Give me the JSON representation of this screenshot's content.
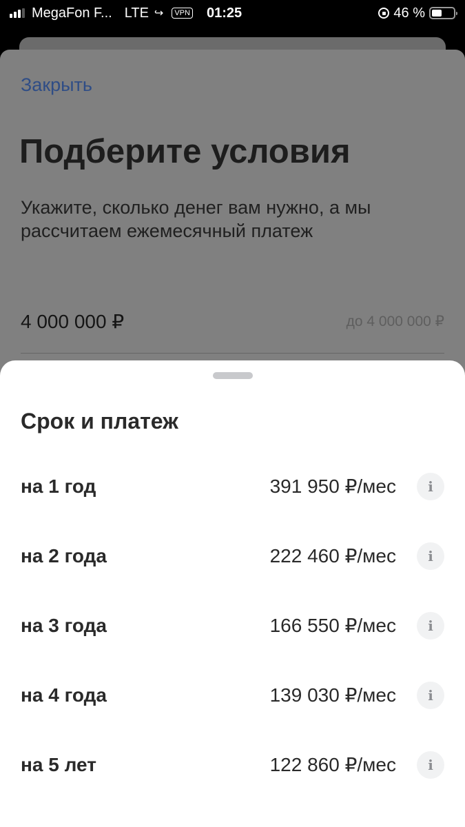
{
  "status_bar": {
    "carrier": "MegaFon F...",
    "network": "LTE",
    "vpn_label": "VPN",
    "time": "01:25",
    "battery_label": "46 %",
    "battery_level_percent": 46
  },
  "background_screen": {
    "close_label": "Закрыть",
    "title": "Подберите условия",
    "subtitle": "Укажите, сколько денег вам нужно, а мы рассчитаем ежемесячный платеж",
    "amount_value": "4 000 000 ₽",
    "amount_max": "до 4 000 000 ₽"
  },
  "sheet": {
    "title": "Срок и платеж",
    "info_icon_glyph": "i",
    "terms": [
      {
        "label": "на 1 год",
        "payment": "391 950 ₽/мес"
      },
      {
        "label": "на 2 года",
        "payment": "222 460 ₽/мес"
      },
      {
        "label": "на 3 года",
        "payment": "166 550 ₽/мес"
      },
      {
        "label": "на 4 года",
        "payment": "139 030 ₽/мес"
      },
      {
        "label": "на 5 лет",
        "payment": "122 860 ₽/мес"
      }
    ]
  },
  "colors": {
    "link": "#2f4d86",
    "overlay_card": "#808080",
    "sheet_bg": "#ffffff",
    "info_bg": "#f1f2f3"
  }
}
